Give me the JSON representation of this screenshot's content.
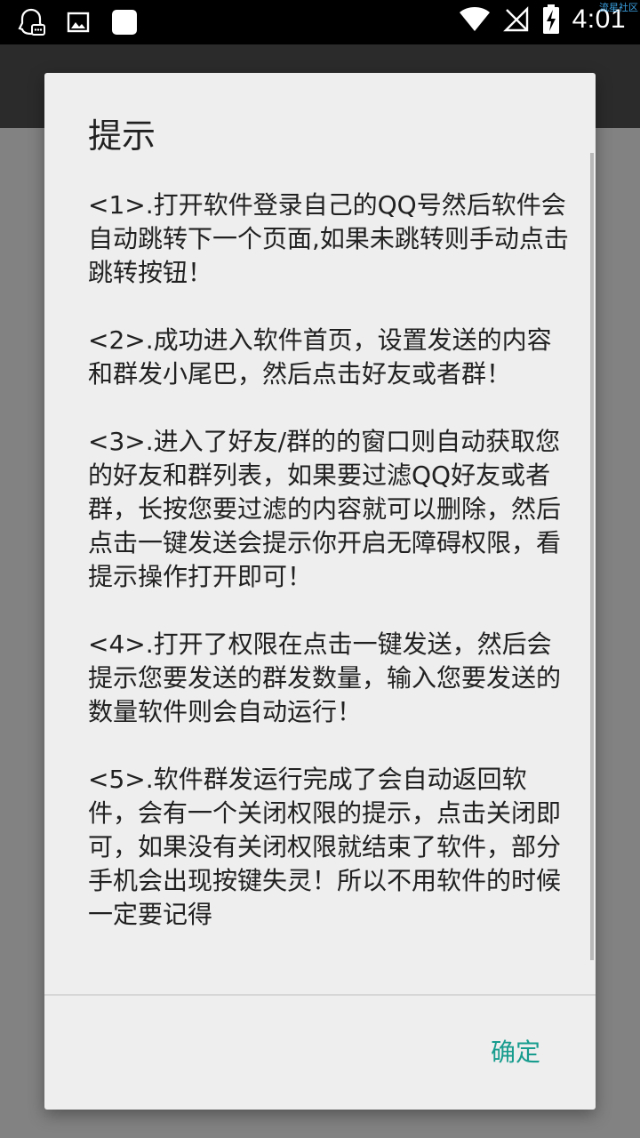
{
  "status_bar": {
    "time": "4:01",
    "watermark": "流星社区",
    "icons": [
      "qq-notification-icon",
      "image-notification-icon",
      "app-notification-icon",
      "wifi-icon",
      "no-signal-icon",
      "battery-charging-icon"
    ]
  },
  "dialog": {
    "title": "提示",
    "paragraphs": [
      "<1>.打开软件登录自己的QQ号然后软件会自动跳转下一个页面,如果未跳转则手动点击跳转按钮！",
      "<2>.成功进入软件首页，设置发送的内容和群发小尾巴，然后点击好友或者群！",
      "<3>.进入了好友/群的的窗口则自动获取您的好友和群列表，如果要过滤QQ好友或者群，长按您要过滤的内容就可以删除，然后点击一键发送会提示你开启无障碍权限，看提示操作打开即可！",
      "<4>.打开了权限在点击一键发送，然后会提示您要发送的群发数量，输入您要发送的数量软件则会自动运行！",
      "<5>.软件群发运行完成了会自动返回软件，会有一个关闭权限的提示，点击关闭即可，如果没有关闭权限就结束了软件，部分手机会出现按键失灵！所以不用软件的时候一定要记得"
    ],
    "ok_label": "确定",
    "accent_color": "#179c8e"
  }
}
